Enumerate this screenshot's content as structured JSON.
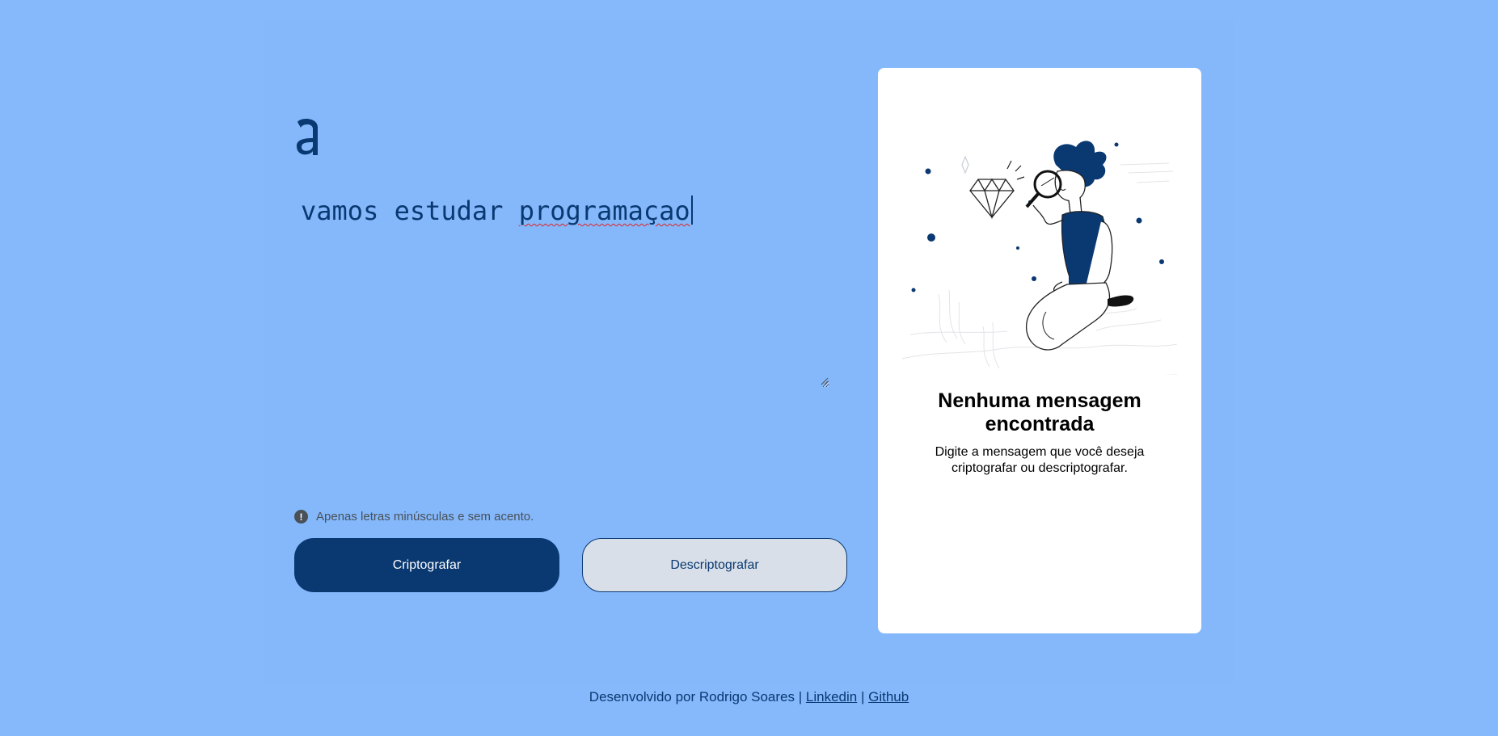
{
  "editor": {
    "text_plain": "vamos estudar ",
    "text_misspelled": "programaçao"
  },
  "hint": {
    "icon": "!",
    "text": "Apenas letras minúsculas e sem acento."
  },
  "buttons": {
    "encrypt_label": "Criptografar",
    "decrypt_label": "Descriptografar"
  },
  "result_card": {
    "title": "Nenhuma mensagem encontrada",
    "message": "Digite a mensagem que você deseja criptografar ou descriptografar."
  },
  "footer": {
    "prefix": "Desenvolvido por Rodrigo Soares",
    "separator": "|",
    "linkedin_label": "Linkedin",
    "github_label": "Github"
  },
  "colors": {
    "page_background": "#86b9fb",
    "primary": "#0a3871",
    "card_background": "#ffffff",
    "secondary_button": "#d8dfe8"
  }
}
